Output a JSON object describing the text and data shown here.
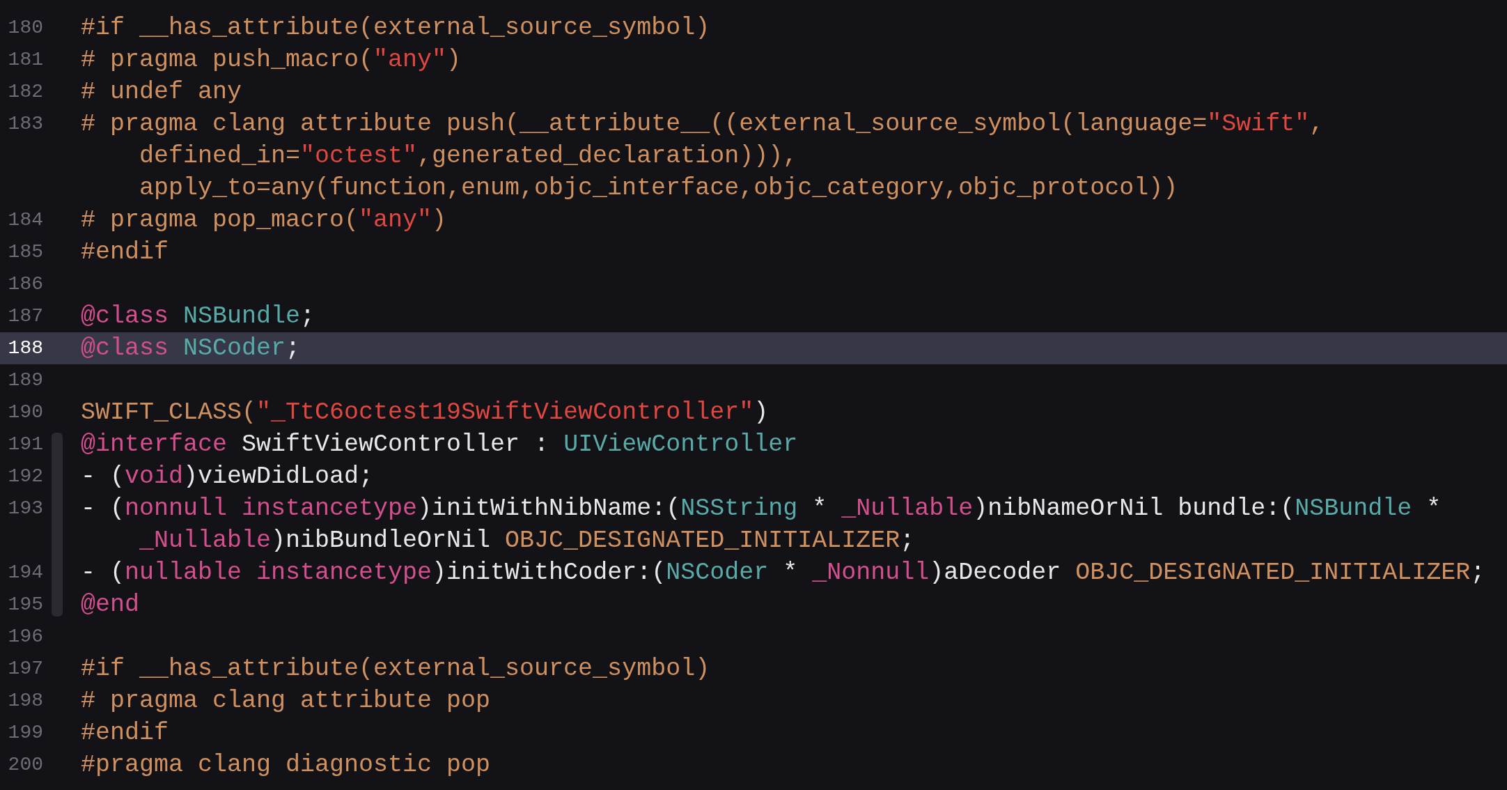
{
  "editor": {
    "lines": [
      {
        "number": "180",
        "selected": false,
        "in_scope": false,
        "rows": [
          {
            "tokens": [
              {
                "kind": "preproc",
                "text": "#if __has_attribute(external_source_symbol)"
              }
            ]
          }
        ]
      },
      {
        "number": "181",
        "selected": false,
        "in_scope": false,
        "rows": [
          {
            "tokens": [
              {
                "kind": "preproc",
                "text": "# pragma push_macro("
              },
              {
                "kind": "string",
                "text": "\"any\""
              },
              {
                "kind": "preproc",
                "text": ")"
              }
            ]
          }
        ]
      },
      {
        "number": "182",
        "selected": false,
        "in_scope": false,
        "rows": [
          {
            "tokens": [
              {
                "kind": "preproc",
                "text": "# undef any"
              }
            ]
          }
        ]
      },
      {
        "number": "183",
        "selected": false,
        "in_scope": false,
        "rows": [
          {
            "tokens": [
              {
                "kind": "preproc",
                "text": "# pragma clang attribute push(__attribute__((external_source_symbol(language="
              },
              {
                "kind": "string",
                "text": "\"Swift\""
              },
              {
                "kind": "preproc",
                "text": ","
              }
            ]
          },
          {
            "tokens": [
              {
                "kind": "preproc",
                "text": "defined_in="
              },
              {
                "kind": "string",
                "text": "\"octest\""
              },
              {
                "kind": "preproc",
                "text": ",generated_declaration))),"
              }
            ]
          },
          {
            "tokens": [
              {
                "kind": "preproc",
                "text": "apply_to=any(function,enum,objc_interface,objc_category,objc_protocol))"
              }
            ]
          }
        ]
      },
      {
        "number": "184",
        "selected": false,
        "in_scope": false,
        "rows": [
          {
            "tokens": [
              {
                "kind": "preproc",
                "text": "# pragma pop_macro("
              },
              {
                "kind": "string",
                "text": "\"any\""
              },
              {
                "kind": "preproc",
                "text": ")"
              }
            ]
          }
        ]
      },
      {
        "number": "185",
        "selected": false,
        "in_scope": false,
        "rows": [
          {
            "tokens": [
              {
                "kind": "preproc",
                "text": "#endif"
              }
            ]
          }
        ]
      },
      {
        "number": "186",
        "selected": false,
        "in_scope": false,
        "rows": [
          {}
        ]
      },
      {
        "number": "187",
        "selected": false,
        "in_scope": false,
        "rows": [
          {
            "tokens": [
              {
                "kind": "keyword",
                "text": "@class"
              },
              {
                "kind": "type",
                "text": " NSBundle"
              },
              {
                "kind": "plain",
                "text": ";"
              }
            ]
          }
        ]
      },
      {
        "number": "188",
        "selected": true,
        "in_scope": false,
        "rows": [
          {
            "tokens": [
              {
                "kind": "keyword",
                "text": "@class"
              },
              {
                "kind": "type",
                "text": " NSCoder"
              },
              {
                "kind": "plain",
                "text": ";"
              }
            ]
          }
        ]
      },
      {
        "number": "189",
        "selected": false,
        "in_scope": false,
        "rows": [
          {}
        ]
      },
      {
        "number": "190",
        "selected": false,
        "in_scope": false,
        "rows": [
          {
            "tokens": [
              {
                "kind": "preproc",
                "text": "SWIFT_CLASS("
              },
              {
                "kind": "string",
                "text": "\"_TtC6octest19SwiftViewController\""
              },
              {
                "kind": "plain",
                "text": ")"
              }
            ]
          }
        ]
      },
      {
        "number": "191",
        "selected": false,
        "in_scope": true,
        "rows": [
          {
            "tokens": [
              {
                "kind": "keyword",
                "text": "@interface"
              },
              {
                "kind": "plain",
                "text": " SwiftViewController : "
              },
              {
                "kind": "type",
                "text": "UIViewController"
              }
            ]
          }
        ]
      },
      {
        "number": "192",
        "selected": false,
        "in_scope": true,
        "rows": [
          {
            "tokens": [
              {
                "kind": "plain",
                "text": "- ("
              },
              {
                "kind": "keyword",
                "text": "void"
              },
              {
                "kind": "plain",
                "text": ")viewDidLoad;"
              }
            ]
          }
        ]
      },
      {
        "number": "193",
        "selected": false,
        "in_scope": true,
        "rows": [
          {
            "tokens": [
              {
                "kind": "plain",
                "text": "- ("
              },
              {
                "kind": "keyword",
                "text": "nonnull instancetype"
              },
              {
                "kind": "plain",
                "text": ")initWithNibName:("
              },
              {
                "kind": "type",
                "text": "NSString"
              },
              {
                "kind": "plain",
                "text": " * "
              },
              {
                "kind": "keyword",
                "text": "_Nullable"
              },
              {
                "kind": "plain",
                "text": ")nibNameOrNil bundle:("
              },
              {
                "kind": "type",
                "text": "NSBundle"
              },
              {
                "kind": "plain",
                "text": " *"
              }
            ]
          },
          {
            "tokens": [
              {
                "kind": "keyword",
                "text": "_Nullable"
              },
              {
                "kind": "plain",
                "text": ")nibBundleOrNil "
              },
              {
                "kind": "preproc",
                "text": "OBJC_DESIGNATED_INITIALIZER"
              },
              {
                "kind": "plain",
                "text": ";"
              }
            ]
          }
        ]
      },
      {
        "number": "194",
        "selected": false,
        "in_scope": true,
        "rows": [
          {
            "tokens": [
              {
                "kind": "plain",
                "text": "- ("
              },
              {
                "kind": "keyword",
                "text": "nullable instancetype"
              },
              {
                "kind": "plain",
                "text": ")initWithCoder:("
              },
              {
                "kind": "type",
                "text": "NSCoder"
              },
              {
                "kind": "plain",
                "text": " * "
              },
              {
                "kind": "keyword",
                "text": "_Nonnull"
              },
              {
                "kind": "plain",
                "text": ")aDecoder "
              },
              {
                "kind": "preproc",
                "text": "OBJC_DESIGNATED_INITIALIZER"
              },
              {
                "kind": "plain",
                "text": ";"
              }
            ]
          }
        ]
      },
      {
        "number": "195",
        "selected": false,
        "in_scope": true,
        "rows": [
          {
            "tokens": [
              {
                "kind": "keyword",
                "text": "@end"
              }
            ]
          }
        ]
      },
      {
        "number": "196",
        "selected": false,
        "in_scope": false,
        "rows": [
          {}
        ]
      },
      {
        "number": "197",
        "selected": false,
        "in_scope": false,
        "rows": [
          {
            "tokens": [
              {
                "kind": "preproc",
                "text": "#if __has_attribute(external_source_symbol)"
              }
            ]
          }
        ]
      },
      {
        "number": "198",
        "selected": false,
        "in_scope": false,
        "rows": [
          {
            "tokens": [
              {
                "kind": "preproc",
                "text": "# pragma clang attribute pop"
              }
            ]
          }
        ]
      },
      {
        "number": "199",
        "selected": false,
        "in_scope": false,
        "rows": [
          {
            "tokens": [
              {
                "kind": "preproc",
                "text": "#endif"
              }
            ]
          }
        ]
      },
      {
        "number": "200",
        "selected": false,
        "in_scope": false,
        "rows": [
          {
            "tokens": [
              {
                "kind": "preproc",
                "text": "#pragma clang diagnostic pop"
              }
            ]
          }
        ]
      }
    ]
  }
}
